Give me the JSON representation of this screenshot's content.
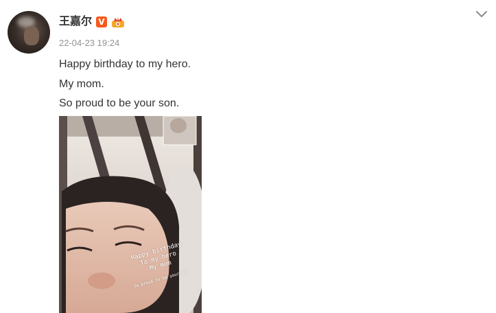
{
  "post": {
    "author": "王嘉尔",
    "vip_badge": "V",
    "timestamp": "22-04-23 19:24",
    "lines": [
      "Happy birthday to my hero.",
      "My mom.",
      "So proud to be your son."
    ],
    "image_caption": {
      "line1": "Happy birthday",
      "line2": "To my hero",
      "line3": "My mom",
      "line4": "So proud to be your son"
    }
  },
  "icons": {
    "more": "chevron-down-icon",
    "vip": "verified-v-icon",
    "crown": "crown-badge-icon"
  },
  "colors": {
    "text": "#333333",
    "timestamp": "#939393",
    "vip_badge": "#f6591c",
    "crown_badge": "#f6a623"
  }
}
